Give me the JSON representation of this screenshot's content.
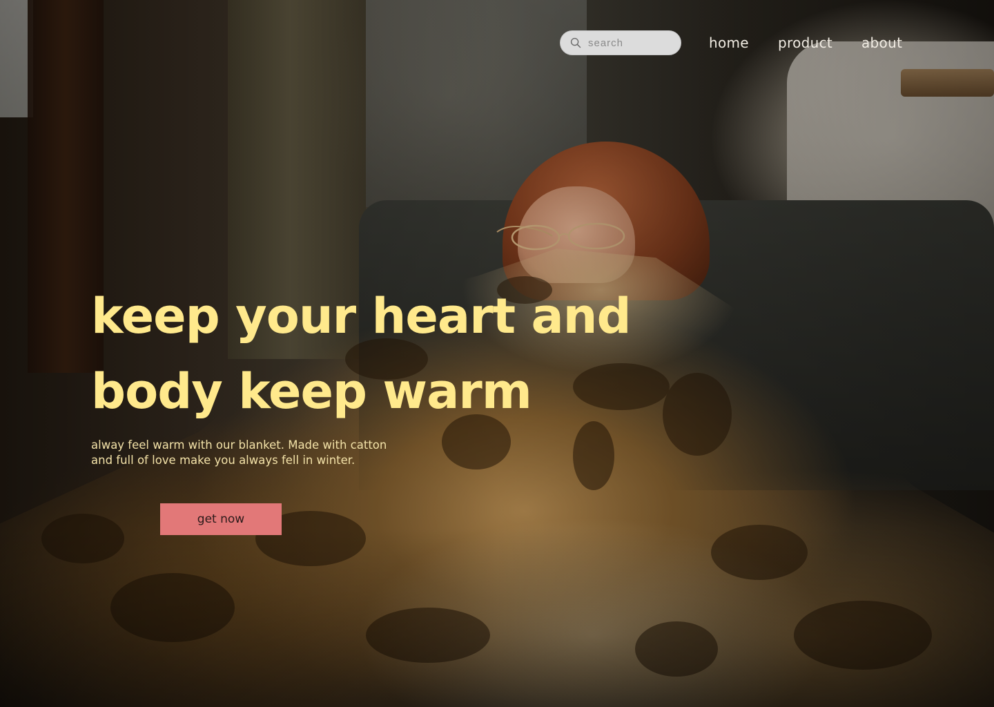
{
  "nav": {
    "search_placeholder": "search",
    "links": [
      {
        "label": "home"
      },
      {
        "label": "product"
      },
      {
        "label": "about"
      }
    ]
  },
  "hero": {
    "title_line1": "keep your heart and",
    "title_line2": "body keep warm",
    "subtitle_line1": "alway feel warm with our blanket. Made with catton",
    "subtitle_line2": "and full of love make you always fell in winter.",
    "cta_label": "get now"
  },
  "colors": {
    "title": "#ffe98c",
    "subtitle": "#f3e2a8",
    "cta_background": "#e27878",
    "nav_text": "#f1ece3",
    "search_background": "#dcdcdc"
  },
  "icons": {
    "search": "search-icon"
  }
}
